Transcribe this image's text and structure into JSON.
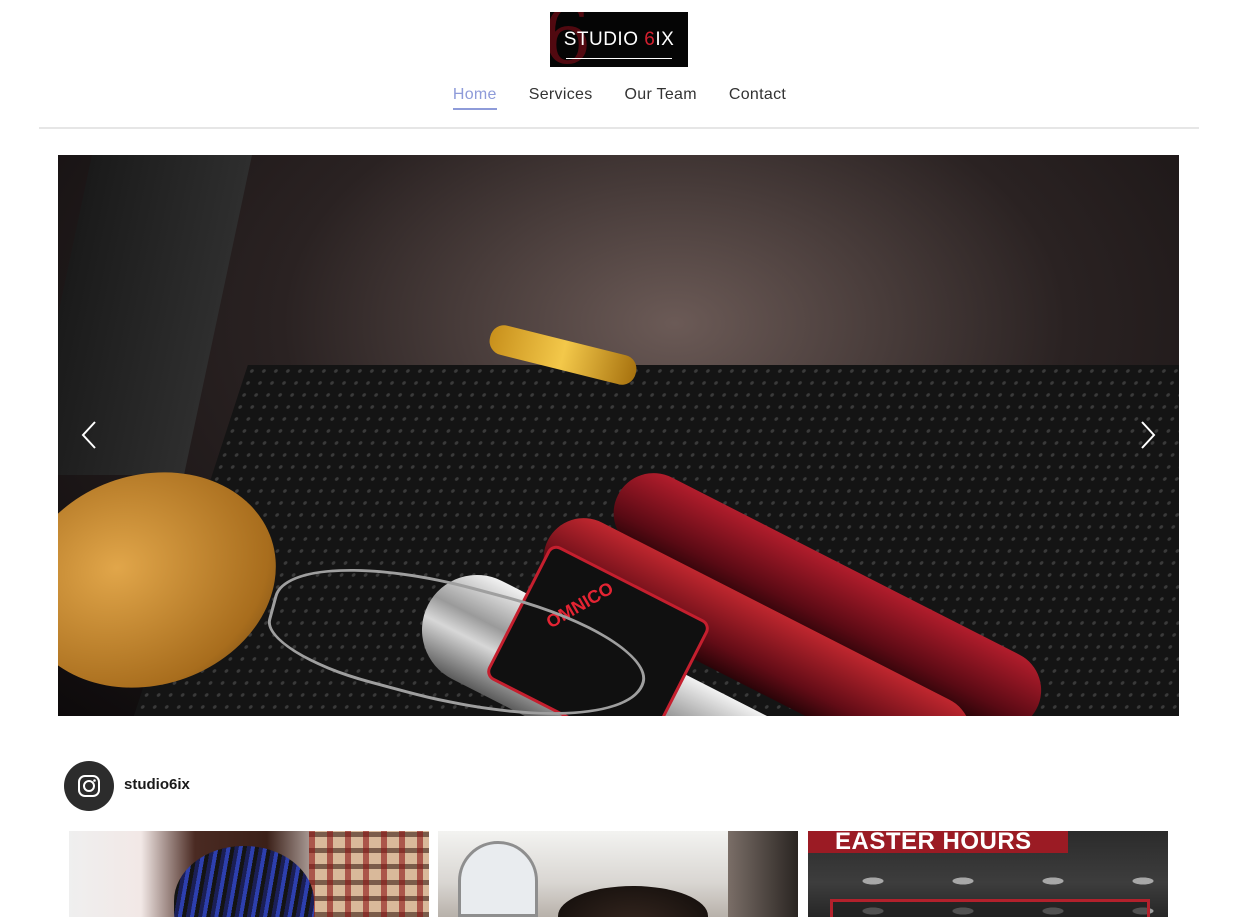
{
  "header": {
    "logo_text_a": "STUDIO ",
    "logo_text_b": "6",
    "logo_text_c": "IX",
    "logo_bg_glyph": "6",
    "nav": [
      {
        "label": "Home",
        "active": true
      },
      {
        "label": "Services",
        "active": false
      },
      {
        "label": "Our Team",
        "active": false
      },
      {
        "label": "Contact",
        "active": false
      }
    ]
  },
  "hero": {
    "image": "barber-clippers-photo",
    "grip_label": "OMNICO",
    "prev_icon": "chevron-left-icon",
    "next_icon": "chevron-right-icon"
  },
  "instagram": {
    "icon": "instagram-icon",
    "handle": "studio6ix",
    "posts": [
      {
        "image": "braided-hair-photo"
      },
      {
        "image": "haircut-photo"
      },
      {
        "image": "easter-hours-graphic",
        "banner_text": "EASTER HOURS"
      }
    ]
  },
  "colors": {
    "accent": "#8e9bd9",
    "brand_red": "#d3202f",
    "logo_bg": "#050505"
  }
}
